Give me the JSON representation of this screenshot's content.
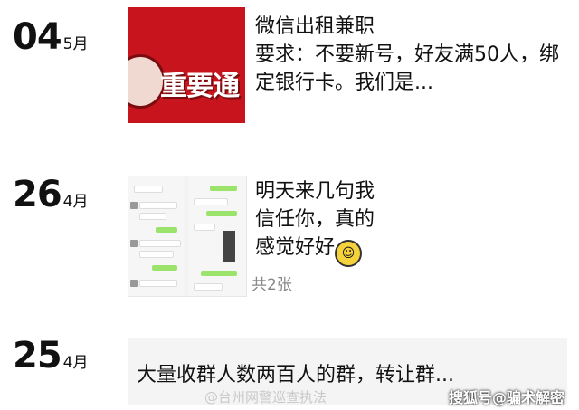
{
  "entries": [
    {
      "day": "04",
      "month": "5月",
      "thumb_type": "red-banner",
      "thumb_text": "重要通",
      "title": "微信出租兼职",
      "body": "要求：不要新号，好友满50人，绑定银行卡。我们是..."
    },
    {
      "day": "26",
      "month": "4月",
      "thumb_type": "chat-screenshot",
      "body": "明天来几句我信任你，真的感觉好好",
      "emoji": "grinning-face",
      "count": "共2张"
    },
    {
      "day": "25",
      "month": "4月",
      "body": "大量收群人数两百人的群，转让群..."
    }
  ],
  "watermarks": {
    "left": "@台州网警巡查执法",
    "right": "搜狐号@骗术解密"
  },
  "colors": {
    "red": "#c8141c",
    "gray_text": "#888888",
    "msg_bg": "#f4f4f4"
  }
}
